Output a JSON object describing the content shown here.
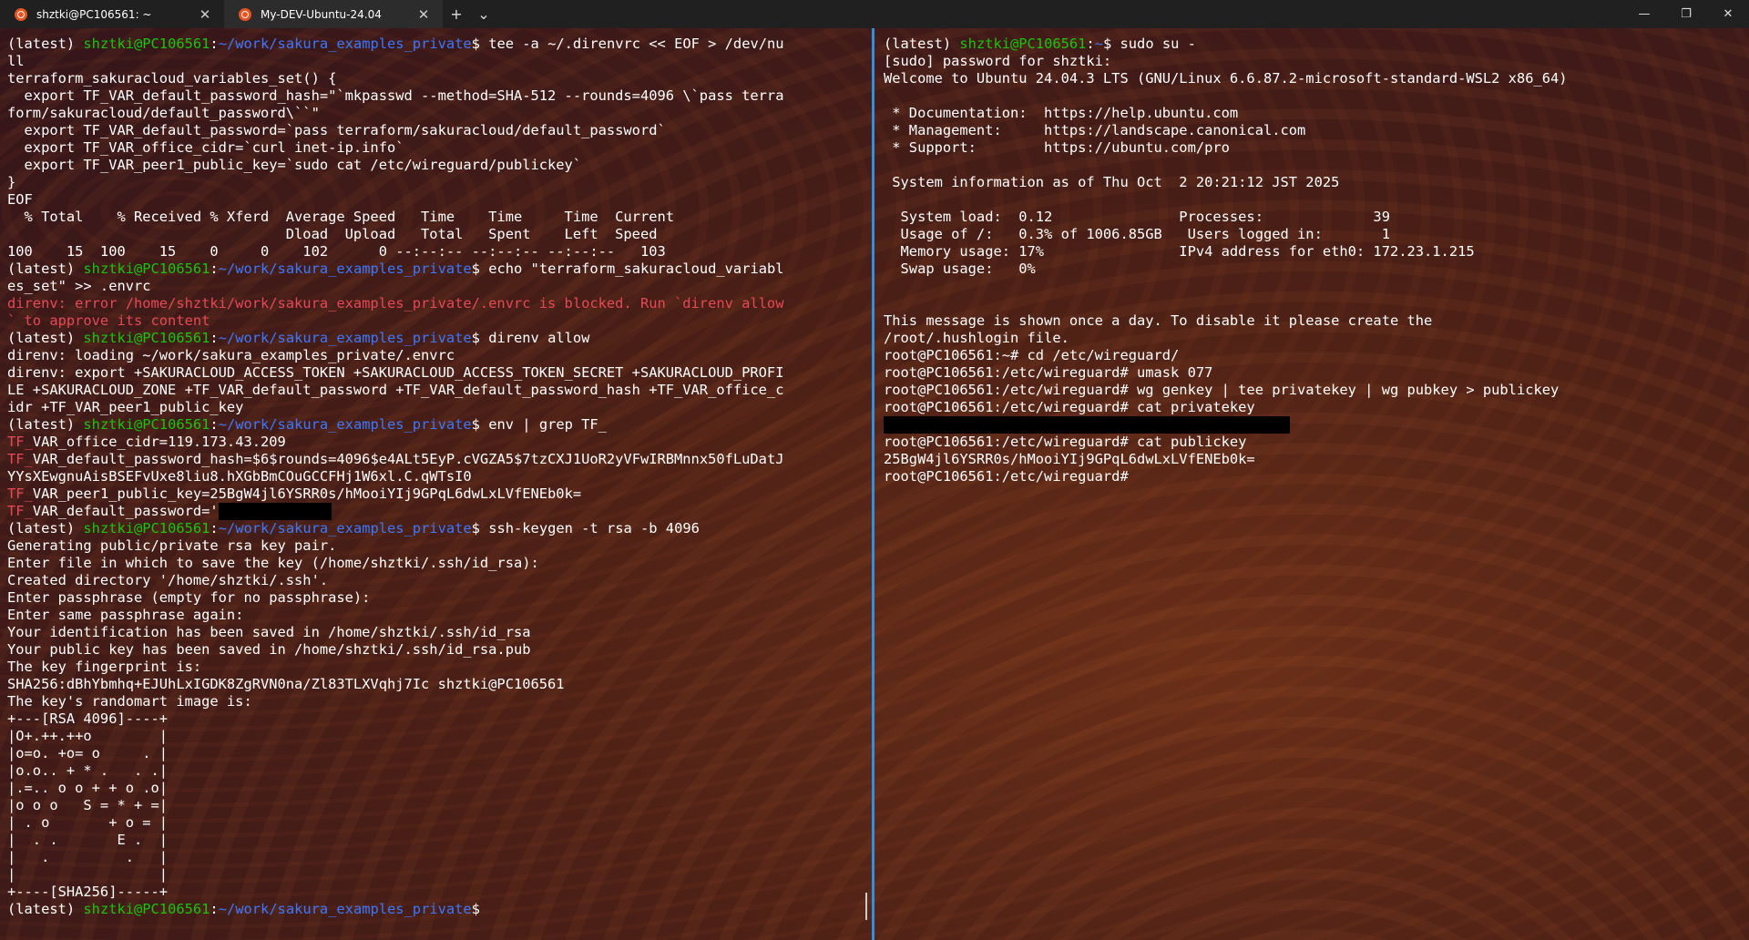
{
  "tabs": [
    {
      "label": "shztki@PC106561: ~",
      "active": false
    },
    {
      "label": "My-DEV-Ubuntu-24.04",
      "active": true
    }
  ],
  "titlebar": {
    "new_tab": "+",
    "dropdown": "⌄",
    "minimize": "—",
    "restore": "❐",
    "close": "✕",
    "tab_close": "✕"
  },
  "colors": {
    "prompt_user": "#16c60c",
    "prompt_path": "#3b78ff",
    "error": "#e74856",
    "pane_divider": "#2f8fe0"
  },
  "prompt": {
    "env": "(latest) ",
    "user_host": "shztki@PC106561",
    "colon": ":",
    "path": "~/work/sakura_examples_private",
    "dollar": "$"
  },
  "left_pane": {
    "cmd1": " tee -a ~/.direnvrc << EOF > /dev/nu",
    "cmd1_wrap": "ll",
    "heredoc": [
      "terraform_sakuracloud_variables_set() {",
      "  export TF_VAR_default_password_hash=\"`mkpasswd --method=SHA-512 --rounds=4096 \\`pass terra",
      "form/sakuracloud/default_password\\``\"",
      "  export TF_VAR_default_password=`pass terraform/sakuracloud/default_password`",
      "  export TF_VAR_office_cidr=`curl inet-ip.info`",
      "  export TF_VAR_peer1_public_key=`sudo cat /etc/wireguard/publickey`",
      "}",
      "EOF"
    ],
    "curl_header1": "  % Total    % Received % Xferd  Average Speed   Time    Time     Time  Current",
    "curl_header2": "                                 Dload  Upload   Total   Spent    Left  Speed",
    "curl_row": "100    15  100    15    0     0    102      0 --:--:-- --:--:-- --:--:--   103",
    "cmd2": " echo \"terraform_sakuracloud_variabl",
    "cmd2_wrap": "es_set\" >> .envrc",
    "error1": "direnv: error /home/shztki/work/sakura_examples_private/.envrc is blocked. Run `direnv allow",
    "error2": "` to approve its content",
    "cmd3": " direnv allow",
    "direnv": [
      "direnv: loading ~/work/sakura_examples_private/.envrc",
      "direnv: export +SAKURACLOUD_ACCESS_TOKEN +SAKURACLOUD_ACCESS_TOKEN_SECRET +SAKURACLOUD_PROFI",
      "LE +SAKURACLOUD_ZONE +TF_VAR_default_password +TF_VAR_default_password_hash +TF_VAR_office_c",
      "idr +TF_VAR_peer1_public_key"
    ],
    "cmd4": " env | grep TF_",
    "tf_prefix": "TF_",
    "env_lines": [
      "VAR_office_cidr=119.173.43.209",
      "VAR_default_password_hash=$6$rounds=4096$e4ALt5EyP.cVGZA5$7tzCXJ1UoR2yVFwIRBMnnx50fLuDatJ"
    ],
    "hash_wrap": "YYsXEwgnuAisBSEFvUxe8liu8.hXGbBmCOuGCCFHj1W6xl.C.qWTsI0",
    "env_peer": "VAR_peer1_public_key=25BgW4jl6YSRR0s/hMooiYIj9GPqL6dwLxLVfENEb0k=",
    "env_pw": "VAR_default_password='",
    "cmd5": " ssh-keygen -t rsa -b 4096",
    "keygen": [
      "Generating public/private rsa key pair.",
      "Enter file in which to save the key (/home/shztki/.ssh/id_rsa):",
      "Created directory '/home/shztki/.ssh'.",
      "Enter passphrase (empty for no passphrase):",
      "Enter same passphrase again:",
      "Your identification has been saved in /home/shztki/.ssh/id_rsa",
      "Your public key has been saved in /home/shztki/.ssh/id_rsa.pub",
      "The key fingerprint is:",
      "SHA256:dBhYbmhq+EJUhLxIGDK8ZgRVN0na/Zl83TLXVqhj7Ic shztki@PC106561",
      "The key's randomart image is:",
      "+---[RSA 4096]----+",
      "|O+.++.++o        |",
      "|o=o. +o= o     . |",
      "|o.o.. + * .   . .|",
      "|.=.. o o + + o .o|",
      "|o o o   S = * + =|",
      "| . o       + o = |",
      "|  . .       E .  |",
      "|   .         .   |",
      "|                 |",
      "+----[SHA256]-----+"
    ]
  },
  "right_pane": {
    "cmd1": " sudo su -",
    "lines": [
      "[sudo] password for shztki:",
      "Welcome to Ubuntu 24.04.3 LTS (GNU/Linux 6.6.87.2-microsoft-standard-WSL2 x86_64)",
      "",
      " * Documentation:  https://help.ubuntu.com",
      " * Management:     https://landscape.canonical.com",
      " * Support:        https://ubuntu.com/pro",
      "",
      " System information as of Thu Oct  2 20:21:12 JST 2025",
      "",
      "  System load:  0.12               Processes:             39",
      "  Usage of /:   0.3% of 1006.85GB   Users logged in:       1",
      "  Memory usage: 17%                IPv4 address for eth0: 172.23.1.215",
      "  Swap usage:   0%",
      "",
      "",
      "This message is shown once a day. To disable it please create the",
      "/root/.hushlogin file.",
      "root@PC106561:~# cd /etc/wireguard/",
      "root@PC106561:/etc/wireguard# umask 077",
      "root@PC106561:/etc/wireguard# wg genkey | tee privatekey | wg pubkey > publickey",
      "root@PC106561:/etc/wireguard# cat privatekey"
    ],
    "after": [
      "root@PC106561:/etc/wireguard# cat publickey",
      "25BgW4jl6YSRR0s/hMooiYIj9GPqL6dwLxLVfENEb0k=",
      "root@PC106561:/etc/wireguard#"
    ]
  }
}
